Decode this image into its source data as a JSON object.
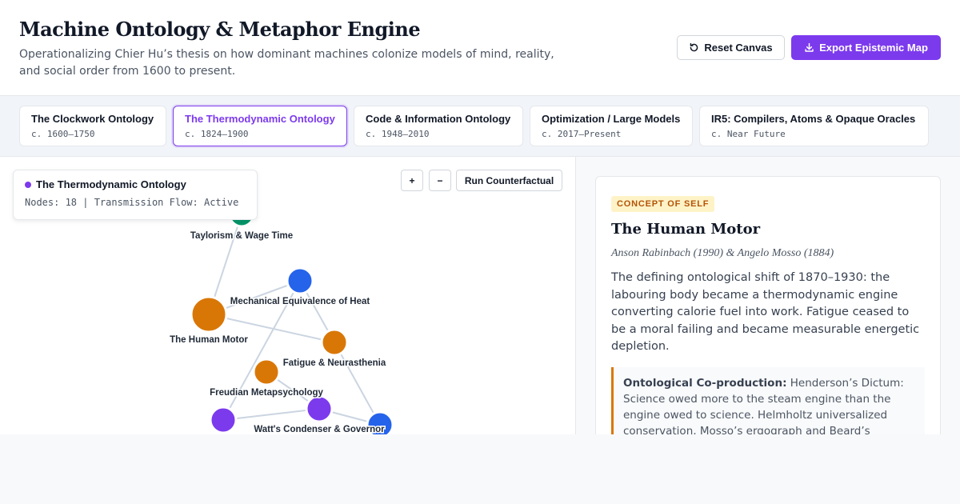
{
  "header": {
    "title": "Machine Ontology & Metaphor Engine",
    "subtitle": "Operationalizing Chier Hu’s thesis on how dominant machines colonize models of mind, reality, and social order from 1600 to present.",
    "reset_label": "Reset Canvas",
    "export_label": "Export Epistemic Map"
  },
  "tabs": [
    {
      "title": "The Clockwork Ontology",
      "range": "c. 1600–1750",
      "active": false
    },
    {
      "title": "The Thermodynamic Ontology",
      "range": "c. 1824–1900",
      "active": true
    },
    {
      "title": "Code & Information Ontology",
      "range": "c. 1948–2010",
      "active": false
    },
    {
      "title": "Optimization / Large Models",
      "range": "c. 2017–Present",
      "active": false
    },
    {
      "title": "IR5: Compilers, Atoms & Opaque Oracles",
      "range": "c. Near Future",
      "active": false
    }
  ],
  "canvas": {
    "info_title": "The Thermodynamic Ontology",
    "info_meta": "Nodes: 18 | Transmission Flow: Active",
    "zoom_in": "+",
    "zoom_out": "−",
    "run_label": "Run Counterfactual",
    "node_labels": {
      "taylorism": "Taylorism & Wage Time",
      "mech_equiv": "Mechanical Equivalence of Heat",
      "human_motor": "The Human Motor",
      "fatigue": "Fatigue & Neurasthenia",
      "freudian": "Freudian Metapsychology",
      "watt": "Watt's Condenser & Governor"
    },
    "colors": {
      "green": "#059669",
      "blue": "#2563eb",
      "orange": "#d97706",
      "purple": "#7c3aed",
      "edge": "#cbd5e1"
    }
  },
  "detail": {
    "badge": "CONCEPT OF SELF",
    "title": "The Human Motor",
    "source": "Anson Rabinbach (1990) & Angelo Mosso (1884)",
    "body": "The defining ontological shift of 1870–1930: the labouring body became a thermodynamic engine converting calorie fuel into work. Fatigue ceased to be a moral failing and became measurable energetic depletion.",
    "quote_label": "Ontological Co-production:",
    "quote_text": " Henderson’s Dictum: Science owed more to the steam engine than the engine owed to science. Helmholtz universalized conservation, Mosso’s ergograph and Beard’s"
  }
}
